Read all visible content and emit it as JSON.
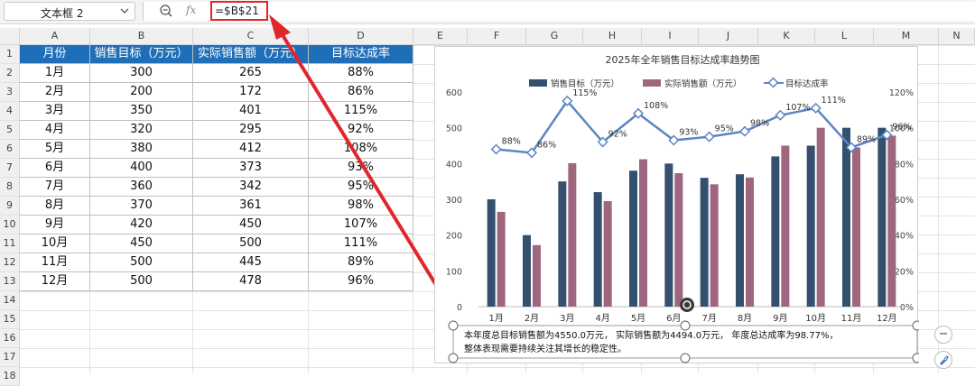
{
  "namebox": {
    "value": "文本框 2"
  },
  "formula_bar": {
    "fx_label": "fx",
    "formula": "=$B$21"
  },
  "columns": [
    "A",
    "B",
    "C",
    "D",
    "E",
    "F",
    "G",
    "H",
    "I",
    "J",
    "K",
    "L",
    "M",
    "N"
  ],
  "rows": [
    "1",
    "2",
    "3",
    "4",
    "5",
    "6",
    "7",
    "8",
    "9",
    "10",
    "11",
    "12",
    "13",
    "14",
    "15",
    "16",
    "17",
    "18"
  ],
  "table": {
    "headers": [
      "月份",
      "销售目标（万元）",
      "实际销售额（万元）",
      "目标达成率"
    ],
    "rows": [
      [
        "1月",
        "300",
        "265",
        "88%"
      ],
      [
        "2月",
        "200",
        "172",
        "86%"
      ],
      [
        "3月",
        "350",
        "401",
        "115%"
      ],
      [
        "4月",
        "320",
        "295",
        "92%"
      ],
      [
        "5月",
        "380",
        "412",
        "108%"
      ],
      [
        "6月",
        "400",
        "373",
        "93%"
      ],
      [
        "7月",
        "360",
        "342",
        "95%"
      ],
      [
        "8月",
        "370",
        "361",
        "98%"
      ],
      [
        "9月",
        "420",
        "450",
        "107%"
      ],
      [
        "10月",
        "450",
        "500",
        "111%"
      ],
      [
        "11月",
        "500",
        "445",
        "89%"
      ],
      [
        "12月",
        "500",
        "478",
        "96%"
      ]
    ]
  },
  "chart_data": {
    "type": "bar",
    "title": "2025年全年销售目标达成率趋势图",
    "categories": [
      "1月",
      "2月",
      "3月",
      "4月",
      "5月",
      "6月",
      "7月",
      "8月",
      "9月",
      "10月",
      "11月",
      "12月"
    ],
    "series": [
      {
        "name": "销售目标（万元）",
        "type": "bar",
        "axis": "left",
        "color": "#34506e",
        "values": [
          300,
          200,
          350,
          320,
          380,
          400,
          360,
          370,
          420,
          450,
          500,
          500
        ]
      },
      {
        "name": "实际销售额（万元）",
        "type": "bar",
        "axis": "left",
        "color": "#a0667f",
        "values": [
          265,
          172,
          401,
          295,
          412,
          373,
          342,
          361,
          450,
          500,
          445,
          478
        ]
      },
      {
        "name": "目标达成率",
        "type": "line",
        "axis": "right",
        "color": "#5b86c5",
        "values": [
          88,
          86,
          115,
          92,
          108,
          93,
          95,
          98,
          107,
          111,
          89,
          96
        ]
      }
    ],
    "point_labels": [
      "88%",
      "86%",
      "115%",
      "92%",
      "108%",
      "93%",
      "95%",
      "98%",
      "107%",
      "111%",
      "89%",
      "96%"
    ],
    "ylim_left": [
      0,
      600
    ],
    "yticks_left": [
      "0",
      "100",
      "200",
      "300",
      "400",
      "500",
      "600"
    ],
    "ylim_right": [
      0,
      120
    ],
    "yticks_right": [
      "0%",
      "20%",
      "40%",
      "60%",
      "80%",
      "100%",
      "120%"
    ],
    "legend_position": "top",
    "grid": false
  },
  "textbox": {
    "line1": "本年度总目标销售额为4550.0万元， 实际销售额为4494.0万元， 年度总达成率为98.77%，",
    "line2": "整体表现需要持续关注其增长的稳定性。"
  },
  "side_buttons": {
    "minus": "−"
  }
}
